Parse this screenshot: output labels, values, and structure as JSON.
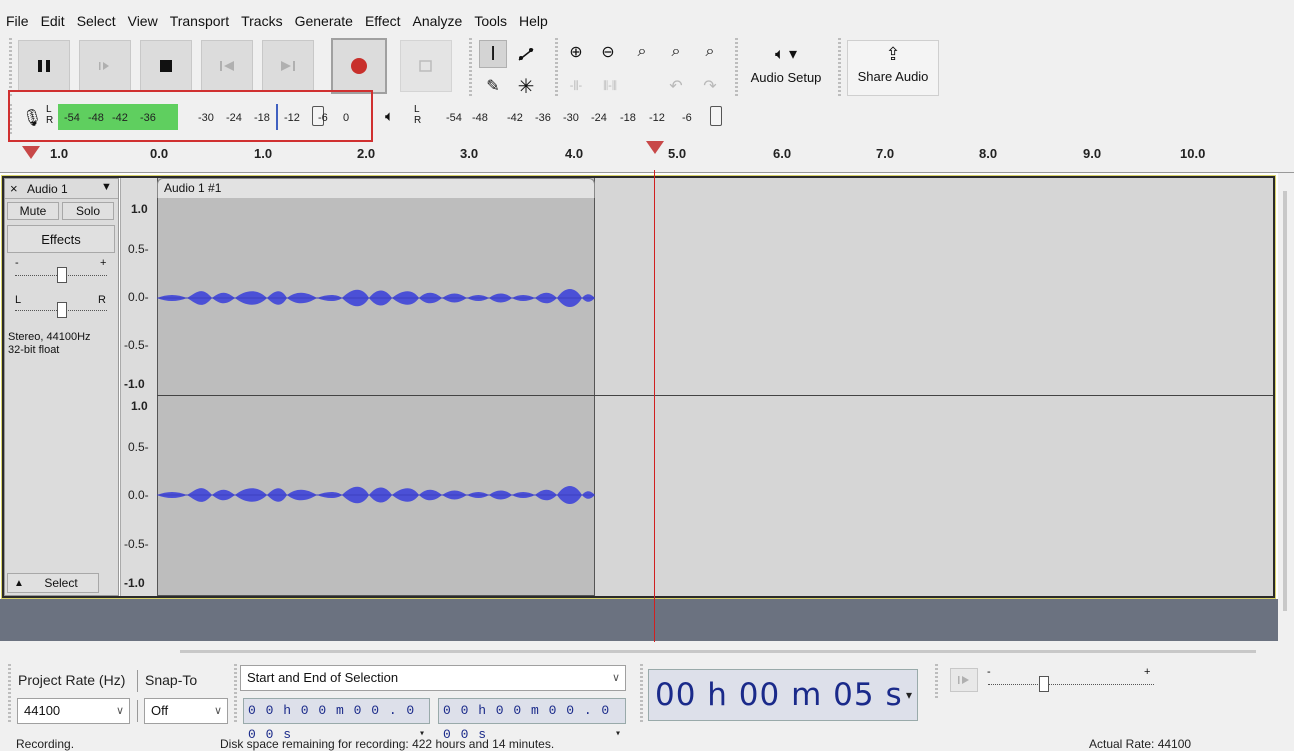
{
  "menu": [
    "File",
    "Edit",
    "Select",
    "View",
    "Transport",
    "Tracks",
    "Generate",
    "Effect",
    "Analyze",
    "Tools",
    "Help"
  ],
  "transport": {
    "pause": "pause-icon",
    "play": "play-icon",
    "stop": "stop-icon",
    "skip_start": "skip-start-icon",
    "skip_end": "skip-end-icon",
    "record": "record-icon",
    "loop": "loop-icon"
  },
  "audio_setup": {
    "label": "Audio Setup",
    "icon": "speaker-icon"
  },
  "share_audio": {
    "label": "Share Audio",
    "icon": "share-icon"
  },
  "meters": {
    "record_ticks": [
      "-54",
      "-48",
      "-42",
      "-36",
      "-30",
      "-24",
      "-18",
      "-12",
      "-6",
      "0"
    ],
    "play_ticks": [
      "-54",
      "-48",
      "-42",
      "-36",
      "-30",
      "-24",
      "-18",
      "-12",
      "-6"
    ],
    "L": "L",
    "R": "R"
  },
  "ruler": {
    "labels": [
      "1.0",
      "0.0",
      "1.0",
      "2.0",
      "3.0",
      "4.0",
      "5.0",
      "6.0",
      "7.0",
      "8.0",
      "9.0",
      "10.0"
    ]
  },
  "track": {
    "name": "Audio 1",
    "close": "×",
    "mute": "Mute",
    "solo": "Solo",
    "effects": "Effects",
    "gain_minus": "-",
    "gain_plus": "+",
    "pan_l": "L",
    "pan_r": "R",
    "info_line1": "Stereo, 44100Hz",
    "info_line2": "32-bit float",
    "select": "Select",
    "clip_name": "Audio 1 #1",
    "vscale_top": [
      "1.0",
      "0.5-",
      "0.0-",
      "-0.5-",
      "-1.0"
    ],
    "vscale_bottom": [
      "1.0",
      "0.5-",
      "0.0-",
      "-0.5-",
      "-1.0"
    ]
  },
  "bottom": {
    "project_rate_label": "Project Rate (Hz)",
    "snap_to_label": "Snap-To",
    "project_rate_value": "44100",
    "snap_value": "Off",
    "selection_mode": "Start and End of Selection",
    "sel_start": "0 0 h 0 0 m 0 0 . 0 0 0 s",
    "sel_end": "0 0 h 0 0 m 0 0 . 0 0 0 s",
    "big_time": "00 h 00 m 05 s"
  },
  "status": {
    "left": "Recording.",
    "middle": "Disk space remaining for recording: 422 hours and 14 minutes.",
    "right": "Actual Rate: 44100"
  },
  "colors": {
    "waveform": "#4b50d6",
    "meter_green": "#5fcf5f",
    "record_red": "#c8302c",
    "highlight_box": "#d03030",
    "cursor": "#d02020"
  }
}
